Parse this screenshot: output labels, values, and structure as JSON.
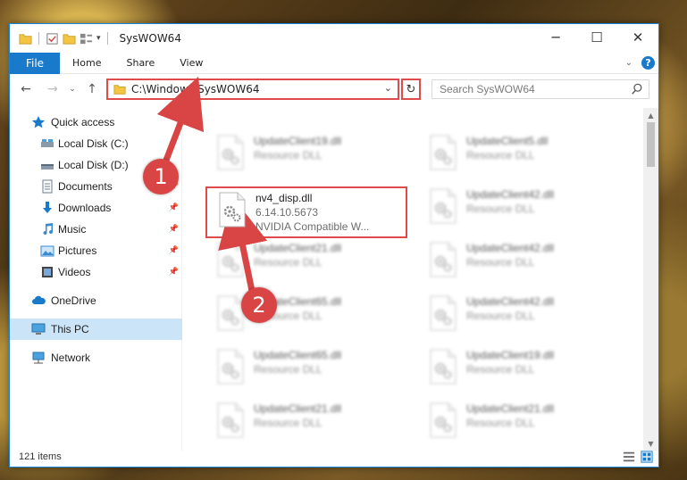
{
  "window": {
    "title": "SysWOW64"
  },
  "ribbon": {
    "file": "File",
    "tabs": [
      "Home",
      "Share",
      "View"
    ]
  },
  "nav": {
    "address": "C:\\Windows\\SysWOW64",
    "search_placeholder": "Search SysWOW64"
  },
  "sidebar": {
    "items": [
      {
        "label": "Quick access",
        "icon": "star-icon",
        "pinned": false
      },
      {
        "label": "Local Disk (C:)",
        "icon": "drive-icon",
        "pinned": false
      },
      {
        "label": "Local Disk (D:)",
        "icon": "drive-icon",
        "pinned": false
      },
      {
        "label": "Documents",
        "icon": "documents-icon",
        "pinned": true
      },
      {
        "label": "Downloads",
        "icon": "download-icon",
        "pinned": true
      },
      {
        "label": "Music",
        "icon": "music-icon",
        "pinned": true
      },
      {
        "label": "Pictures",
        "icon": "pictures-icon",
        "pinned": true
      },
      {
        "label": "Videos",
        "icon": "videos-icon",
        "pinned": true
      },
      {
        "label": "OneDrive",
        "icon": "cloud-icon",
        "pinned": false
      },
      {
        "label": "This PC",
        "icon": "computer-icon",
        "pinned": false,
        "selected": true
      },
      {
        "label": "Network",
        "icon": "network-icon",
        "pinned": false
      }
    ]
  },
  "files": {
    "left": [
      {
        "name": "UpdateClient19.dll",
        "type": "Resource DLL"
      },
      {
        "name": "nv4_disp.dll",
        "version": "6.14.10.5673",
        "description": "NVIDIA Compatible W...",
        "highlighted": true
      },
      {
        "name": "UpdateClient21.dll",
        "type": "Resource DLL"
      },
      {
        "name": "UpdateClient65.dll",
        "type": "Resource DLL"
      },
      {
        "name": "UpdateClient65.dll",
        "type": "Resource DLL"
      },
      {
        "name": "UpdateClient21.dll",
        "type": "Resource DLL"
      }
    ],
    "right": [
      {
        "name": "UpdateClient5.dll",
        "type": "Resource DLL"
      },
      {
        "name": "UpdateClient42.dll",
        "type": "Resource DLL"
      },
      {
        "name": "UpdateClient42.dll",
        "type": "Resource DLL"
      },
      {
        "name": "UpdateClient42.dll",
        "type": "Resource DLL"
      },
      {
        "name": "UpdateClient19.dll",
        "type": "Resource DLL"
      },
      {
        "name": "UpdateClient21.dll",
        "type": "Resource DLL"
      }
    ]
  },
  "status": {
    "count": "121 items"
  },
  "annotations": [
    {
      "label": "1"
    },
    {
      "label": "2"
    }
  ],
  "colors": {
    "accent": "#1979ca",
    "highlight": "#e04a4a",
    "selected": "#cce4f7"
  }
}
